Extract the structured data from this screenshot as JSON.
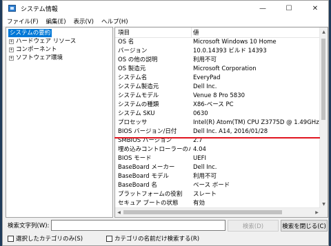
{
  "window": {
    "title": "システム情報",
    "controls": {
      "minimize": "—",
      "maximize": "☐",
      "close": "✕"
    }
  },
  "menu": [
    "ファイル(F)",
    "編集(E)",
    "表示(V)",
    "ヘルプ(H)"
  ],
  "tree": {
    "root": "システムの要約",
    "children": [
      {
        "label": "ハードウェア リソース",
        "expander": "+"
      },
      {
        "label": "コンポーネント",
        "expander": "+"
      },
      {
        "label": "ソフトウェア環境",
        "expander": "+"
      }
    ]
  },
  "list": {
    "columns": [
      "項目",
      "値"
    ],
    "rows": [
      [
        "OS 名",
        "Microsoft Windows 10 Home"
      ],
      [
        "バージョン",
        "10.0.14393 ビルド 14393"
      ],
      [
        "OS の他の説明",
        "利用不可"
      ],
      [
        "OS 製造元",
        "Microsoft Corporation"
      ],
      [
        "システム名",
        "EveryPad"
      ],
      [
        "システム製造元",
        "Dell Inc."
      ],
      [
        "システムモデル",
        "Venue 8 Pro 5830"
      ],
      [
        "システムの種類",
        "X86-ベース PC"
      ],
      [
        "システム SKU",
        "0630"
      ],
      [
        "プロセッサ",
        "Intel(R) Atom(TM) CPU  Z3775D @ 1.49GHz, 1495"
      ],
      [
        "BIOS バージョン/日付",
        "Dell Inc. A14, 2016/01/28"
      ],
      [
        "SMBIOS バージョン",
        "2.7"
      ],
      [
        "埋め込みコントローラーのバージョ...",
        "4.04"
      ],
      [
        "BIOS モード",
        "UEFI"
      ],
      [
        "BaseBoard メーカー",
        "Dell Inc."
      ],
      [
        "BaseBoard モデル",
        "利用不可"
      ],
      [
        "BaseBoard 名",
        "ベース ボード"
      ],
      [
        "プラットフォームの役割",
        "スレート"
      ],
      [
        "セキュア ブートの状態",
        "有効"
      ]
    ],
    "highlight_color": "#e0141e"
  },
  "scroll": {
    "up": "▲",
    "down": "▼",
    "left": "◀",
    "right": "▶"
  },
  "search": {
    "label": "検索文字列(W):",
    "value": "",
    "search_button": "検索(D)",
    "close_search_button": "検索を閉じる(C)",
    "option_selected_category": "選択したカテゴリのみ(S)",
    "option_category_names": "カテゴリの名前だけ検索する(R)"
  },
  "colors": {
    "selection": "#0078d7"
  }
}
